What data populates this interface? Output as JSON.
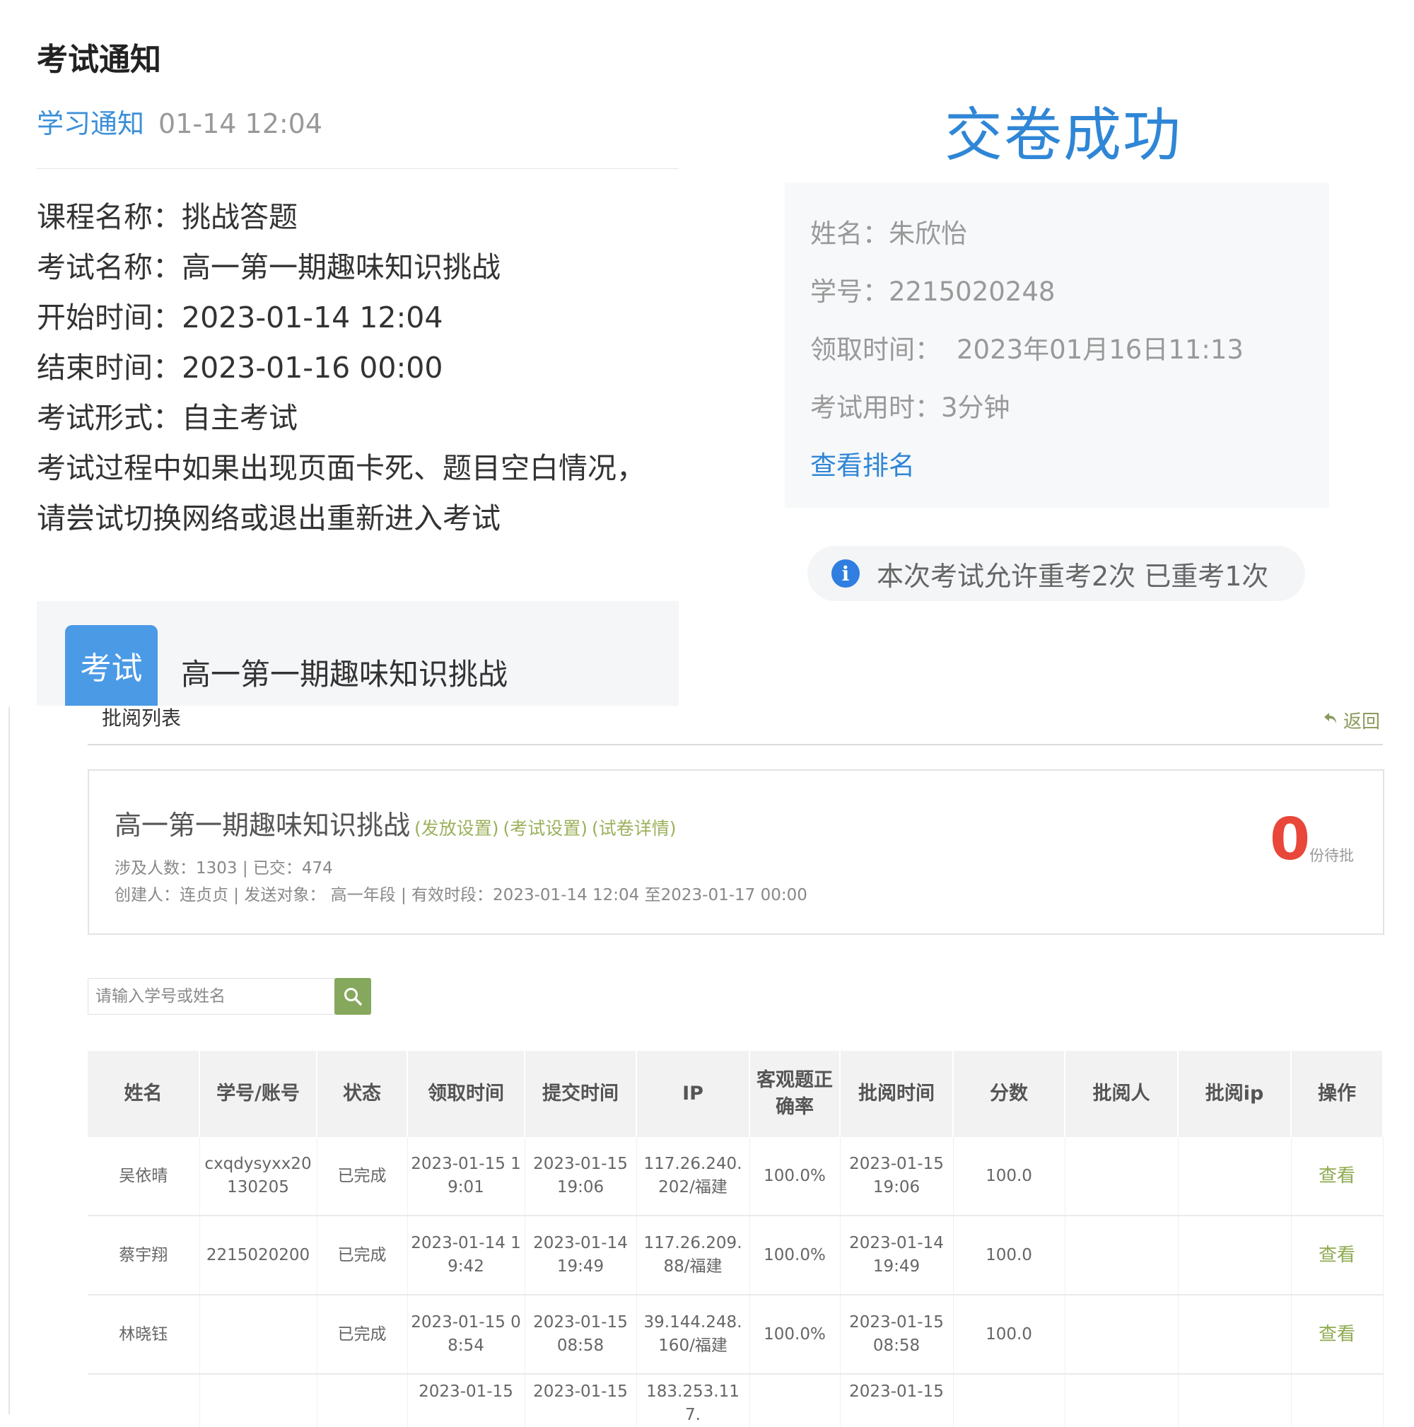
{
  "notice": {
    "title": "考试通知",
    "source": "学习通知",
    "time": "01-14 12:04",
    "rows": [
      {
        "label": "课程名称：",
        "value": "挑战答题"
      },
      {
        "label": "考试名称：",
        "value": "高一第一期趣味知识挑战"
      },
      {
        "label": "开始时间：",
        "value": "2023-01-14 12:04"
      },
      {
        "label": "结束时间：",
        "value": "2023-01-16 00:00"
      },
      {
        "label": "考试形式：",
        "value": "自主考试"
      }
    ],
    "tip_line1": "考试过程中如果出现页面卡死、题目空白情况，",
    "tip_line2": "请尝试切换网络或退出重新进入考试",
    "exam_tag": "考试",
    "exam_name": "高一第一期趣味知识挑战"
  },
  "success": {
    "title": "交卷成功",
    "name_label": "姓名：",
    "name": "朱欣怡",
    "id_label": "学号：",
    "id": "2215020248",
    "receive_label": "领取时间：",
    "receive": "2023年01月16日11:13",
    "duration_label": "考试用时：",
    "duration": "3分钟",
    "rank_link": "查看排名",
    "retake_icon": "i",
    "retake_text": "本次考试允许重考2次 已重考1次"
  },
  "review": {
    "title": "批阅列表",
    "back": "返回",
    "exam_title": "高一第一期趣味知识挑战",
    "links": [
      "(发放设置)",
      "(考试设置)",
      "(试卷详情)"
    ],
    "stats": "涉及人数：1303 | 已交：474",
    "creator": "创建人：连贞贞 | 发送对象：  高一年段  |  有效时段：2023-01-14 12:04 至2023-01-17 00:00",
    "pending_count": "0",
    "pending_label": "份待批",
    "search_placeholder": "请输入学号或姓名",
    "columns": [
      "姓名",
      "学号/账号",
      "状态",
      "领取时间",
      "提交时间",
      "IP",
      "客观题正确率",
      "批阅时间",
      "分数",
      "批阅人",
      "批阅ip",
      "操作"
    ],
    "rows": [
      [
        "吴依晴",
        "cxqdysyxx20130205",
        "已完成",
        "2023-01-15 19:01",
        "2023-01-15 19:06",
        "117.26.240.202/福建",
        "100.0%",
        "2023-01-15 19:06",
        "100.0",
        "",
        "",
        "查看"
      ],
      [
        "蔡宇翔",
        "2215020200",
        "已完成",
        "2023-01-14 19:42",
        "2023-01-14 19:49",
        "117.26.209.88/福建",
        "100.0%",
        "2023-01-14 19:49",
        "100.0",
        "",
        "",
        "查看"
      ],
      [
        "林晓钰",
        "",
        "已完成",
        "2023-01-15 08:54",
        "2023-01-15 08:58",
        "39.144.248.160/福建",
        "100.0%",
        "2023-01-15 08:58",
        "100.0",
        "",
        "",
        "查看"
      ]
    ],
    "partial_row": [
      "",
      "",
      "",
      "2023-01-15",
      "2023-01-15",
      "183.253.117.",
      "",
      "2023-01-15",
      "",
      "",
      "",
      ""
    ]
  }
}
